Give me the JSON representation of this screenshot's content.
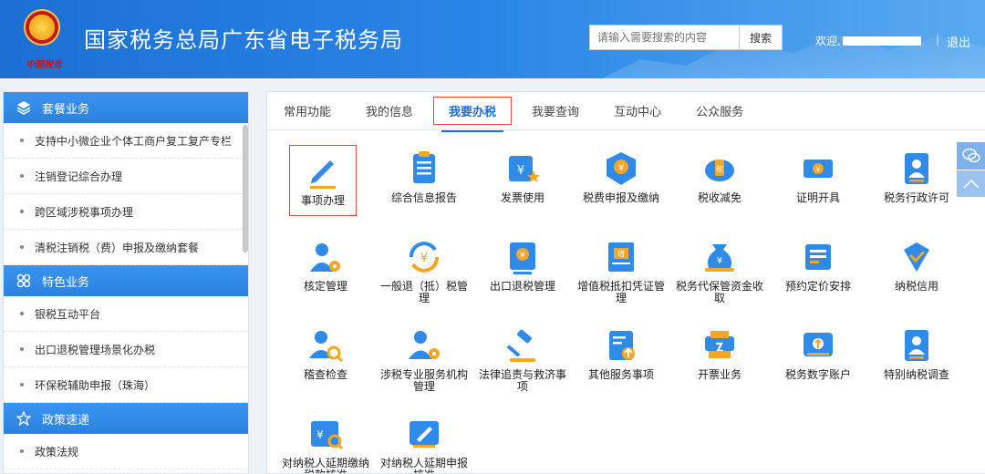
{
  "header": {
    "title": "国家税务总局广东省电子税务局",
    "emblem_caption": "中国税务",
    "search_placeholder": "请输入需要搜索的内容",
    "search_button": "搜索",
    "welcome": "欢迎,",
    "divider": "|",
    "logout": "退出"
  },
  "sidebar": {
    "groups": [
      {
        "title": "套餐业务",
        "icon": "layers-icon",
        "items": [
          "支持中小微企业个体工商户复工复产专栏",
          "注销登记综合办理",
          "跨区域涉税事项办理",
          "清税注销税（费）申报及缴纳套餐"
        ]
      },
      {
        "title": "特色业务",
        "icon": "grid-icon",
        "items": [
          "银税互动平台",
          "出口退税管理场景化办税",
          "环保税辅助申报（珠海）"
        ]
      },
      {
        "title": "政策速递",
        "icon": "star-icon",
        "items": [
          "政策法规"
        ]
      }
    ]
  },
  "tabs": [
    "常用功能",
    "我的信息",
    "我要办税",
    "我要查询",
    "互动中心",
    "公众服务"
  ],
  "active_tab": "我要办税",
  "functions": [
    {
      "label": "事项办理",
      "icon": "pen-icon",
      "selected": true
    },
    {
      "label": "综合信息报告",
      "icon": "document-list-icon"
    },
    {
      "label": "发票使用",
      "icon": "invoice-star-icon"
    },
    {
      "label": "税费申报及缴纳",
      "icon": "tax-cube-icon"
    },
    {
      "label": "税收减免",
      "icon": "tax-reduce-icon"
    },
    {
      "label": "证明开具",
      "icon": "certificate-ticket-icon"
    },
    {
      "label": "税务行政许可",
      "icon": "person-card-icon"
    },
    {
      "label": "核定管理",
      "icon": "person-gear-icon"
    },
    {
      "label": "一般退（抵）税管理",
      "icon": "refund-cycle-icon"
    },
    {
      "label": "出口退税管理",
      "icon": "export-refund-icon"
    },
    {
      "label": "增值税抵扣凭证管理",
      "icon": "vat-ticket-icon"
    },
    {
      "label": "税务代保管资金收取",
      "icon": "money-bag-icon"
    },
    {
      "label": "预约定价安排",
      "icon": "price-doc-icon"
    },
    {
      "label": "纳税信用",
      "icon": "diamond-check-icon"
    },
    {
      "label": "稽查检查",
      "icon": "person-search-icon"
    },
    {
      "label": "涉税专业服务机构管理",
      "icon": "agency-gear-icon"
    },
    {
      "label": "法律追责与救济事项",
      "icon": "gavel-icon"
    },
    {
      "label": "其他服务事项",
      "icon": "doc-upload-icon"
    },
    {
      "label": "开票业务",
      "icon": "printer-icon"
    },
    {
      "label": "税务数字账户",
      "icon": "digital-account-icon"
    },
    {
      "label": "特别纳税调查",
      "icon": "person-card-2-icon"
    },
    {
      "label": "对纳税人延期缴纳税款核准",
      "icon": "defer-pay-icon"
    },
    {
      "label": "对纳税人延期申报核准",
      "icon": "defer-declare-icon"
    }
  ],
  "float_buttons": [
    "wechat-icon",
    "arrow-up-icon"
  ],
  "colors": {
    "header_blue": "#2a86e6",
    "icon_blue": "#2f8ae8",
    "icon_orange": "#f5a623",
    "active_tab": "#1f6fd6",
    "highlight_red": "#e84545"
  }
}
